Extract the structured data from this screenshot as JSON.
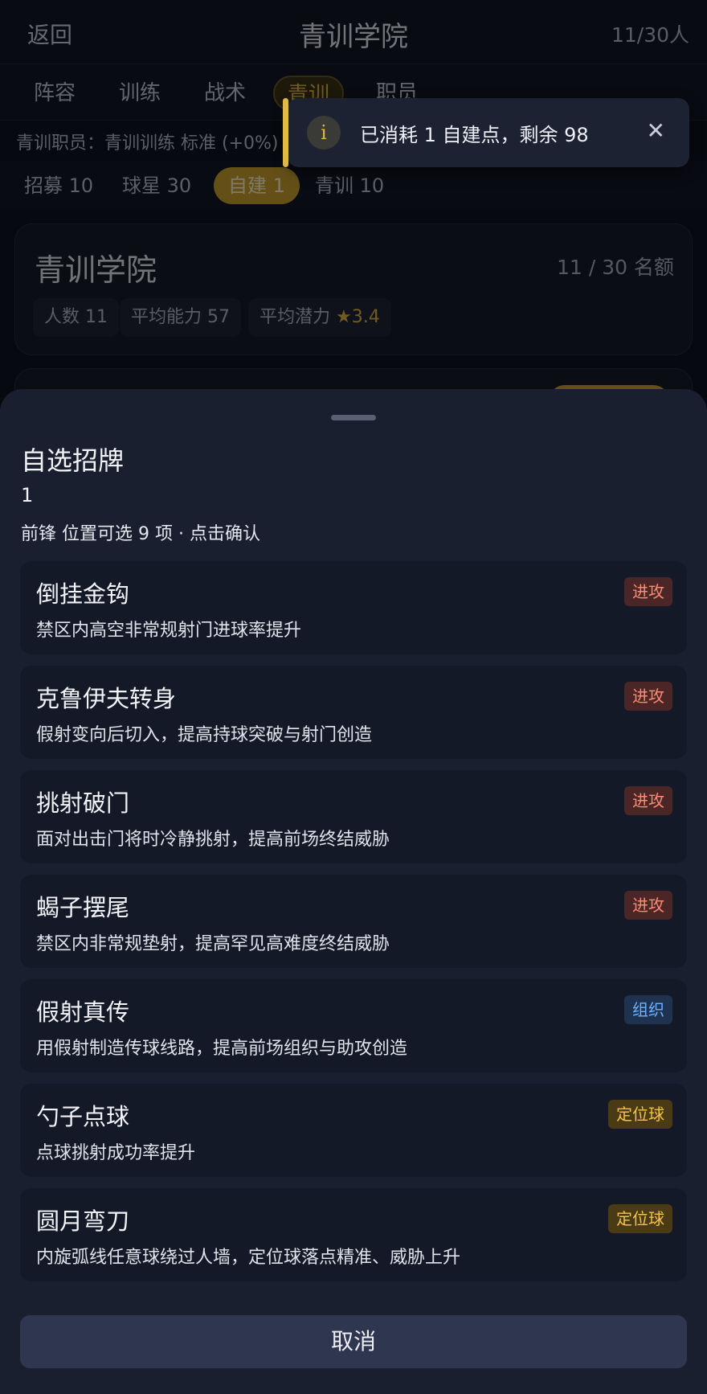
{
  "header": {
    "back_label": "返回",
    "title": "青训学院",
    "quota": "11/30人"
  },
  "tabs": [
    "阵容",
    "训练",
    "战术",
    "青训",
    "职员"
  ],
  "staff_line": "青训职员：青训训练 标准 (+0%)",
  "filters": [
    "招募 10",
    "球星 30",
    "自建 1",
    "青训 10"
  ],
  "academy_card": {
    "title": "青训学院",
    "quota": "11 / 30 名额",
    "stat_count": "人数 11",
    "stat_ability": "平均能力 57",
    "stat_potential_label": "平均潜力",
    "stat_potential_star": "★",
    "stat_potential_value": "3.4"
  },
  "toast": {
    "icon": "i",
    "text": "已消耗 1 自建点，剩余 98",
    "close": "✕"
  },
  "sheet": {
    "title": "自选招牌",
    "count": "1",
    "subtitle": "前锋 位置可选 9 项 · 点击确认",
    "cancel_label": "取消",
    "skills": [
      {
        "name": "倒挂金钩",
        "desc": "禁区内高空非常规射门进球率提升",
        "tag": "进攻"
      },
      {
        "name": "克鲁伊夫转身",
        "desc": "假射变向后切入，提高持球突破与射门创造",
        "tag": "进攻"
      },
      {
        "name": "挑射破门",
        "desc": "面对出击门将时冷静挑射，提高前场终结威胁",
        "tag": "进攻"
      },
      {
        "name": "蝎子摆尾",
        "desc": "禁区内非常规垫射，提高罕见高难度终结威胁",
        "tag": "进攻"
      },
      {
        "name": "假射真传",
        "desc": "用假射制造传球线路，提高前场组织与助攻创造",
        "tag": "组织"
      },
      {
        "name": "勺子点球",
        "desc": "点球挑射成功率提升",
        "tag": "定位球"
      },
      {
        "name": "圆月弯刀",
        "desc": "内旋弧线任意球绕过人墙，定位球落点精准、威胁上升",
        "tag": "定位球"
      }
    ]
  },
  "colors": {
    "accent": "#e0b845",
    "attack": "#ff8a72",
    "organize": "#6cb0ff",
    "setpiece": "#f2c34a"
  }
}
